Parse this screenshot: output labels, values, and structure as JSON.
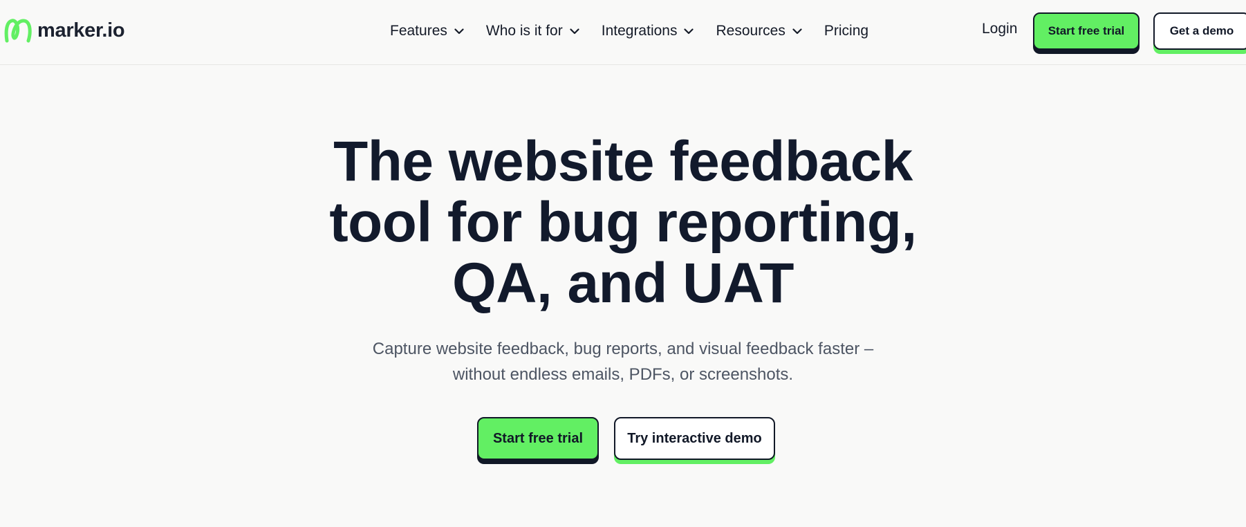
{
  "brand": {
    "name": "marker.io",
    "logo_icon": "marker-io-logo-icon",
    "accent_color": "#62ef63",
    "ink_color": "#111827"
  },
  "nav": {
    "items": [
      {
        "label": "Features",
        "has_dropdown": true
      },
      {
        "label": "Who is it for",
        "has_dropdown": true
      },
      {
        "label": "Integrations",
        "has_dropdown": true
      },
      {
        "label": "Resources",
        "has_dropdown": true
      },
      {
        "label": "Pricing",
        "has_dropdown": false
      }
    ],
    "login_label": "Login",
    "trial_label": "Start free trial",
    "demo_label": "Get a demo"
  },
  "hero": {
    "title_lines": [
      "The website feedback",
      "tool for bug reporting,",
      "QA, and UAT"
    ],
    "subtitle_lines": [
      "Capture website feedback, bug reports, and visual feedback faster –",
      "without endless emails, PDFs, or screenshots."
    ],
    "primary_cta": "Start free trial",
    "secondary_cta": "Try interactive demo"
  }
}
